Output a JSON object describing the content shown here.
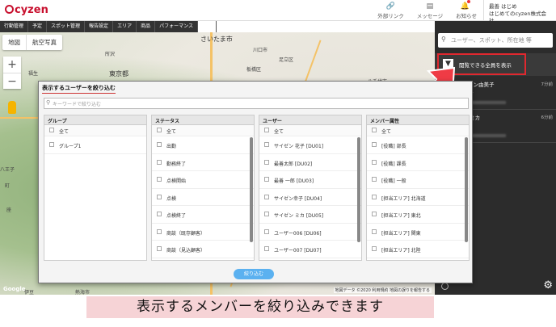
{
  "app": {
    "logo": "cyzen"
  },
  "header": {
    "links": [
      {
        "label": "外部リンク",
        "icon": "link-icon"
      },
      {
        "label": "メッセージ",
        "icon": "message-icon"
      },
      {
        "label": "お知らせ",
        "icon": "bell-icon"
      }
    ],
    "user_name": "最善 はじめ",
    "user_company": "はじめてのcyzen株式会社"
  },
  "nav": [
    "行動管理",
    "予定",
    "スポット管理",
    "報告設定",
    "エリア",
    "商品",
    "パフォーマンス",
    "設定"
  ],
  "map": {
    "tabs": [
      "地図",
      "航空写真"
    ],
    "zoom_in": "+",
    "zoom_out": "−",
    "labels": [
      {
        "text": "さいたま市"
      },
      {
        "text": "川口市"
      },
      {
        "text": "足立区"
      },
      {
        "text": "板橋区"
      },
      {
        "text": "東京都"
      },
      {
        "text": "八千代市"
      },
      {
        "text": "所沢"
      },
      {
        "text": "福生"
      },
      {
        "text": "八王子"
      },
      {
        "text": "町"
      },
      {
        "text": "座"
      },
      {
        "text": "熱海市"
      },
      {
        "text": "伊豆"
      }
    ],
    "brand": "Google",
    "attribution": "地図データ ©2020  利用規約  地図の誤りを報告する"
  },
  "right_panel": {
    "search_placeholder": "ユーザー、スポット、所在地 等",
    "filter_label": "閲覧できる全員を表示",
    "members": [
      {
        "name": "サイゼン由美子",
        "status": "業開始",
        "time": "7分前"
      },
      {
        "name": "ゼン ミカ",
        "status": "動",
        "time": "6分前"
      }
    ]
  },
  "modal": {
    "title": "表示するユーザーを絞り込む",
    "search_placeholder": "キーワードで絞り込む",
    "apply_label": "絞り込む",
    "columns": [
      {
        "header": "グループ",
        "all": "全て",
        "items": [
          "グループ1"
        ]
      },
      {
        "header": "ステータス",
        "all": "全て",
        "items": [
          "出勤",
          "勤務終了",
          "点検開始",
          "点検",
          "点検終了",
          "商談（既存顧客）",
          "商談（見込顧客）"
        ]
      },
      {
        "header": "ユーザー",
        "all": "全て",
        "items": [
          "サイゼン 花子 [DU01]",
          "最善太郎 [DU02]",
          "最善 一郎 [DU03]",
          "サイゼン幸子 [DU04]",
          "サイゼン ミカ [DU05]",
          "ユーザー006 [DU06]",
          "ユーザー007 [DU07]"
        ]
      },
      {
        "header": "メンバー属性",
        "all": "全て",
        "items": [
          "[役職] 部長",
          "[役職] 課長",
          "[役職] 一般",
          "[担当エリア] 北海道",
          "[担当エリア] 東北",
          "[担当エリア] 関東",
          "[担当エリア] 北陸"
        ]
      }
    ]
  },
  "caption": "表示するメンバーを絞り込みできます",
  "colors": {
    "accent": "#c8102e",
    "highlight_border": "#e0282f",
    "apply_button": "#5bb1f0",
    "caption_bg": "#f6d3d6"
  }
}
